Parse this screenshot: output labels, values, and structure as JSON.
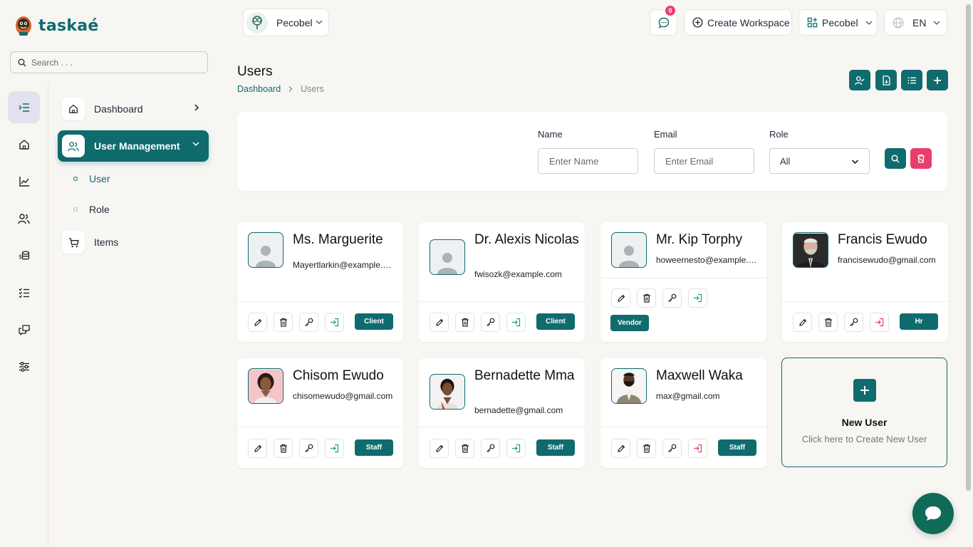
{
  "brand": {
    "name": "taskaé"
  },
  "sidebar": {
    "search_placeholder": "Search . . .",
    "nav": [
      {
        "label": "Dashboard"
      },
      {
        "label": "User Management"
      },
      {
        "label": "User"
      },
      {
        "label": "Role"
      },
      {
        "label": "Items"
      }
    ]
  },
  "header": {
    "workspace": "Pecobel",
    "notification_count": "0",
    "create_workspace": "Create Workspace",
    "company": "Pecobel",
    "language": "EN"
  },
  "page": {
    "title": "Users",
    "breadcrumb": {
      "home": "Dashboard",
      "current": "Users"
    }
  },
  "filters": {
    "name_label": "Name",
    "name_placeholder": "Enter Name",
    "email_label": "Email",
    "email_placeholder": "Enter Email",
    "role_label": "Role",
    "role_value": "All"
  },
  "users": [
    {
      "name": "Ms. Marguerite",
      "email": "Mayertlarkin@example.com",
      "role": "Client"
    },
    {
      "name": "Dr. Alexis Nicolas",
      "email": "fwisozk@example.com",
      "role": "Client"
    },
    {
      "name": "Mr. Kip Torphy",
      "email": "howeernesto@example.com",
      "role": "Vendor"
    },
    {
      "name": "Francis Ewudo",
      "email": "francisewudo@gmail.com",
      "role": "Hr"
    },
    {
      "name": "Chisom Ewudo",
      "email": "chisomewudo@gmail.com",
      "role": "Staff"
    },
    {
      "name": "Bernadette Mma",
      "email": "bernadette@gmail.com",
      "role": "Staff"
    },
    {
      "name": "Maxwell Waka",
      "email": "max@gmail.com",
      "role": "Staff"
    }
  ],
  "new_user": {
    "title": "New User",
    "subtitle": "Click here to Create New User"
  },
  "colors": {
    "primary": "#0f6b6e",
    "danger": "#e83e6c",
    "background": "#f8f6f2"
  }
}
